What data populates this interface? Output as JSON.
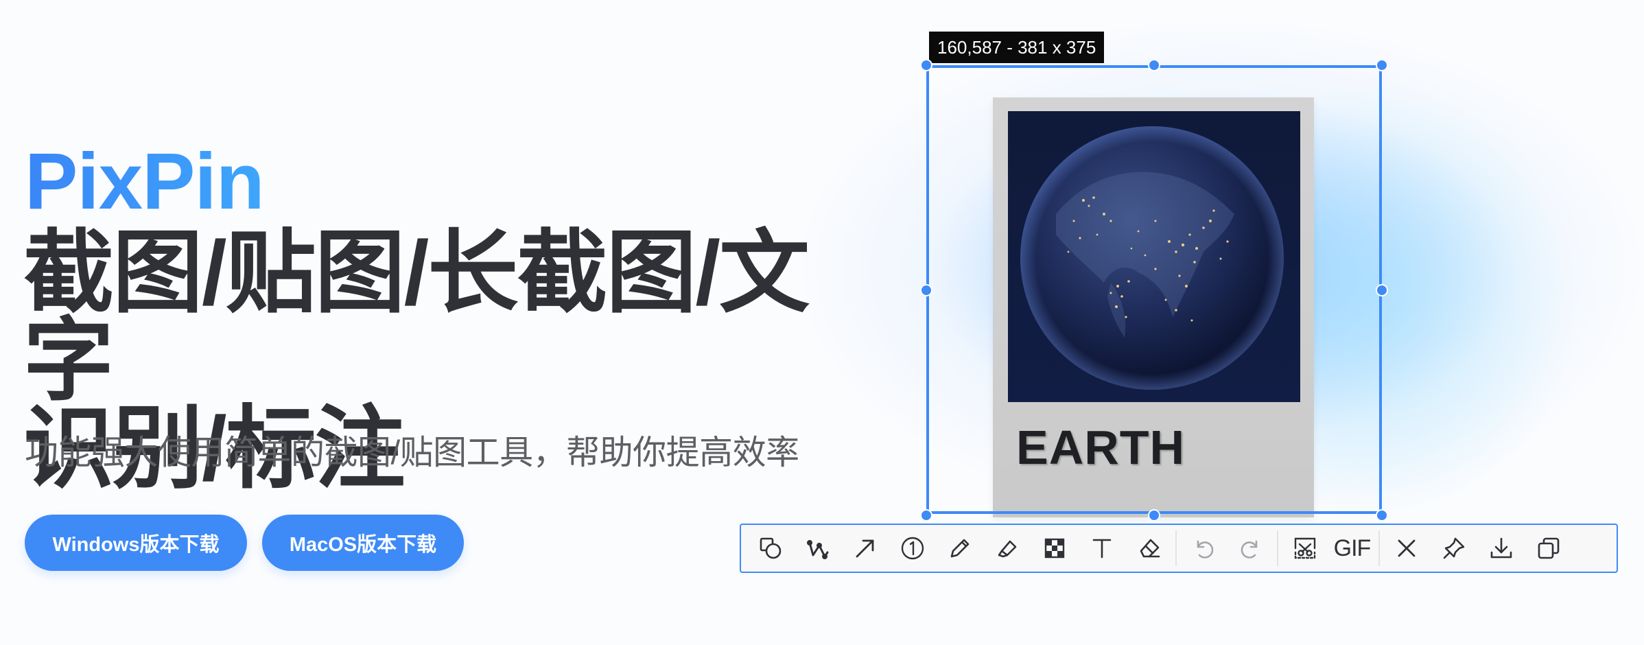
{
  "hero": {
    "brand": "PixPin",
    "headline_line1": "截图/贴图/长截图/文字",
    "headline_line2": "识别/标注",
    "subtitle": "功能强大使用简单的截图/贴图工具，帮助你提高效率",
    "buttons": {
      "windows": "Windows版本下载",
      "macos": "MacOS版本下载"
    }
  },
  "selection": {
    "info": "160,587 - 381 x 375"
  },
  "card": {
    "title": "EARTH"
  },
  "toolbar": {
    "gif_label": "GIF",
    "tools": [
      "shape-icon",
      "polyline-icon",
      "arrow-icon",
      "number-marker-icon",
      "pencil-icon",
      "highlighter-icon",
      "mosaic-icon",
      "text-icon",
      "eraser-icon",
      "undo-icon",
      "redo-icon",
      "long-screenshot-icon",
      "gif-icon",
      "close-icon",
      "pin-icon",
      "save-icon",
      "copy-icon"
    ]
  },
  "colors": {
    "accent": "#3e8af7",
    "headline": "#2f3136",
    "subtitle": "#5d5f63"
  }
}
